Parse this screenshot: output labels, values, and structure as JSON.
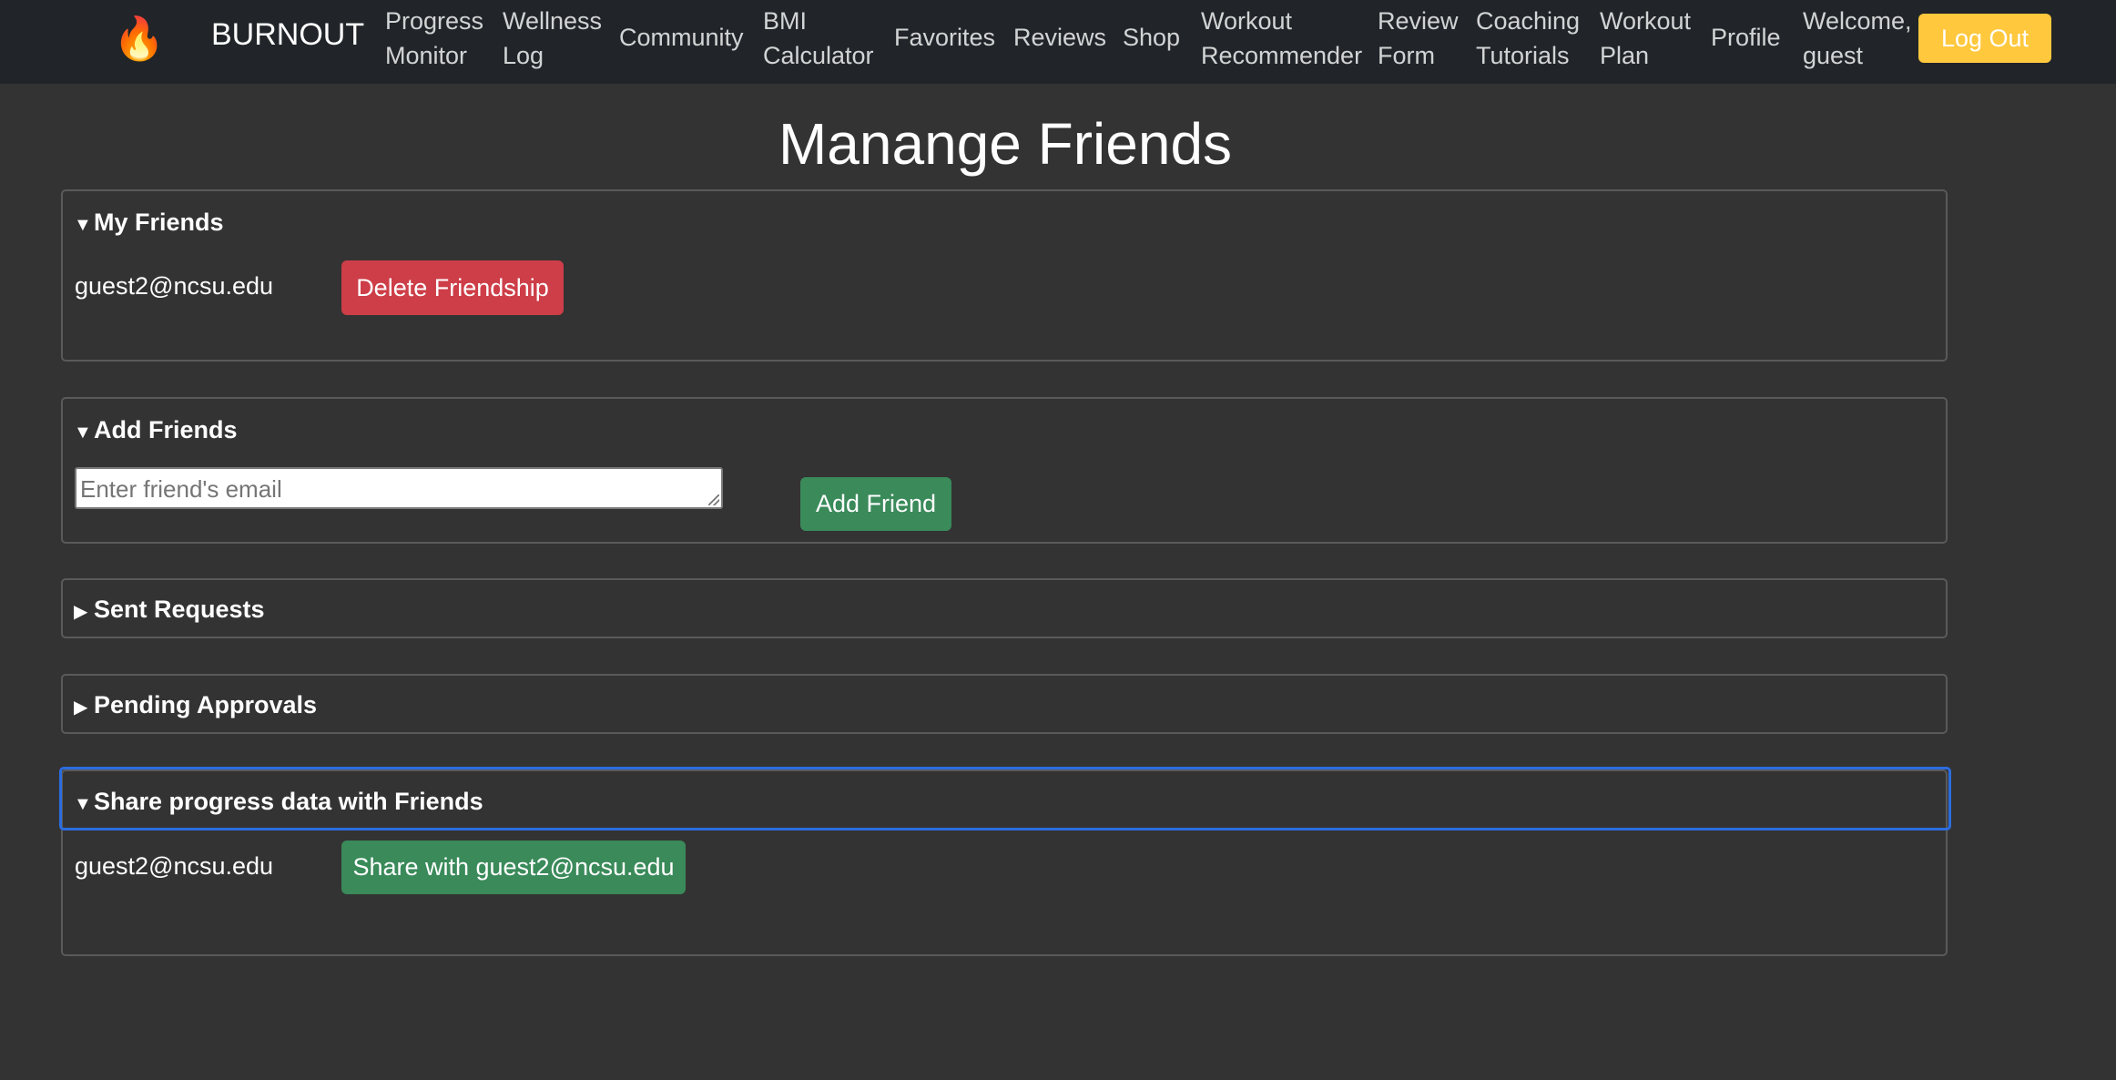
{
  "nav": {
    "logo_icon": "fire-icon",
    "logo_glyph": "🔥",
    "brand": "BURNOUT",
    "items": [
      "Progress\nMonitor",
      "Wellness\nLog",
      "Community",
      "BMI\nCalculator",
      "Favorites",
      "Reviews",
      "Shop",
      "Workout\nRecommender",
      "Review\nForm",
      "Coaching\nTutorials",
      "Workout\nPlan",
      "Profile"
    ],
    "welcome": "Welcome,\nguest",
    "logout_label": "Log Out"
  },
  "page_title": "Manange Friends",
  "sections": {
    "my_friends": {
      "title": "My Friends",
      "friend_email": "guest2@ncsu.edu",
      "delete_label": "Delete Friendship"
    },
    "add_friends": {
      "title": "Add Friends",
      "email_placeholder": "Enter friend's email",
      "add_label": "Add Friend"
    },
    "sent_requests": {
      "title": "Sent Requests"
    },
    "pending_approvals": {
      "title": "Pending Approvals"
    },
    "share_progress": {
      "title": "Share progress data with Friends",
      "friend_email": "guest2@ncsu.edu",
      "share_label": "Share with guest2@ncsu.edu"
    }
  },
  "colors": {
    "background": "#333333",
    "navbar": "#212529",
    "logout": "#ffc83d",
    "danger": "#cd3e48",
    "success": "#3a8a5a",
    "focus": "#2b6de0"
  }
}
